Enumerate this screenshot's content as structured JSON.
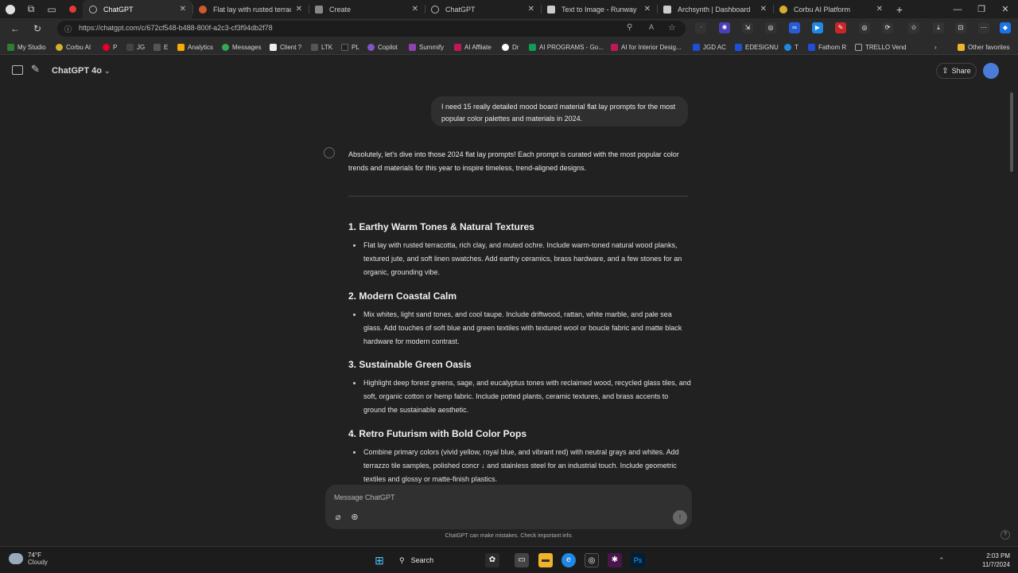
{
  "browser": {
    "tabs": [
      {
        "label": "ChatGPT",
        "active": true,
        "favicon_color": "#10a37f"
      },
      {
        "label": "Flat lay with rusted terracotta",
        "active": false,
        "favicon_color": "#d05a2b"
      },
      {
        "label": "Create",
        "active": false,
        "favicon_color": "#888888"
      },
      {
        "label": "ChatGPT",
        "active": false,
        "favicon_color": "#10a37f"
      },
      {
        "label": "Text to Image - Runway",
        "active": false,
        "favicon_color": "#cccccc"
      },
      {
        "label": "Archsynth | Dashboard",
        "active": false,
        "favicon_color": "#cccccc"
      },
      {
        "label": "Corbu AI Platform",
        "active": false,
        "favicon_color": "#d4b12a"
      }
    ],
    "url": "https://chatgpt.com/c/672cf548-b488-800f-a2c3-cf3f94db2f78",
    "bookmarks": [
      "My Studio",
      "Corbu AI",
      "P",
      "JG",
      "E",
      "Analytics",
      "Messages",
      "Client ?",
      "LTK",
      "PL",
      "Copilot",
      "Summify",
      "AI Affliate",
      "Dr",
      "AI PROGRAMS - Go...",
      "AI for Interior Desig...",
      "JGD AC",
      "EDESIGNU",
      "T",
      "Fathom R",
      "TRELLO Vend"
    ],
    "other_favorites": "Other favorites"
  },
  "app": {
    "model_label": "ChatGPT 4o",
    "share_label": "Share"
  },
  "conversation": {
    "user_message": "I need 15 really detailed mood board material flat lay prompts for the most popular color palettes and materials in 2024.",
    "intro": "Absolutely, let's dive into those 2024 flat lay prompts! Each prompt is curated with the most popular color trends and materials for this year to inspire timeless, trend-aligned designs.",
    "sections": [
      {
        "title": "1. Earthy Warm Tones & Natural Textures",
        "body": "Flat lay with rusted terracotta, rich clay, and muted ochre. Include warm-toned natural wood planks, textured jute, and soft linen swatches. Add earthy ceramics, brass hardware, and a few stones for an organic, grounding vibe."
      },
      {
        "title": "2. Modern Coastal Calm",
        "body": "Mix whites, light sand tones, and cool taupe. Include driftwood, rattan, white marble, and pale sea glass. Add touches of soft blue and green textiles with textured wool or boucle fabric and matte black hardware for modern contrast."
      },
      {
        "title": "3. Sustainable Green Oasis",
        "body": "Highlight deep forest greens, sage, and eucalyptus tones with reclaimed wood, recycled glass tiles, and soft, organic cotton or hemp fabric. Include potted plants, ceramic textures, and brass accents to ground the sustainable aesthetic."
      },
      {
        "title": "4. Retro Futurism with Bold Color Pops",
        "body": "Combine primary colors (vivid yellow, royal blue, and vibrant red) with neutral grays and whites. Add terrazzo tile samples, polished concr ↓ and stainless steel for an industrial touch. Include geometric textiles and glossy or matte-finish plastics."
      }
    ]
  },
  "composer": {
    "placeholder": "Message ChatGPT",
    "disclaimer": "ChatGPT can make mistakes. Check important info."
  },
  "taskbar": {
    "weather_temp": "74°F",
    "weather_cond": "Cloudy",
    "search_label": "Search",
    "time": "2:03 PM",
    "date": "11/7/2024"
  },
  "colors": {
    "background": "#212121",
    "user_bubble": "#2f2f2f",
    "composer": "#303030",
    "avatar": "#4a7dd9"
  }
}
